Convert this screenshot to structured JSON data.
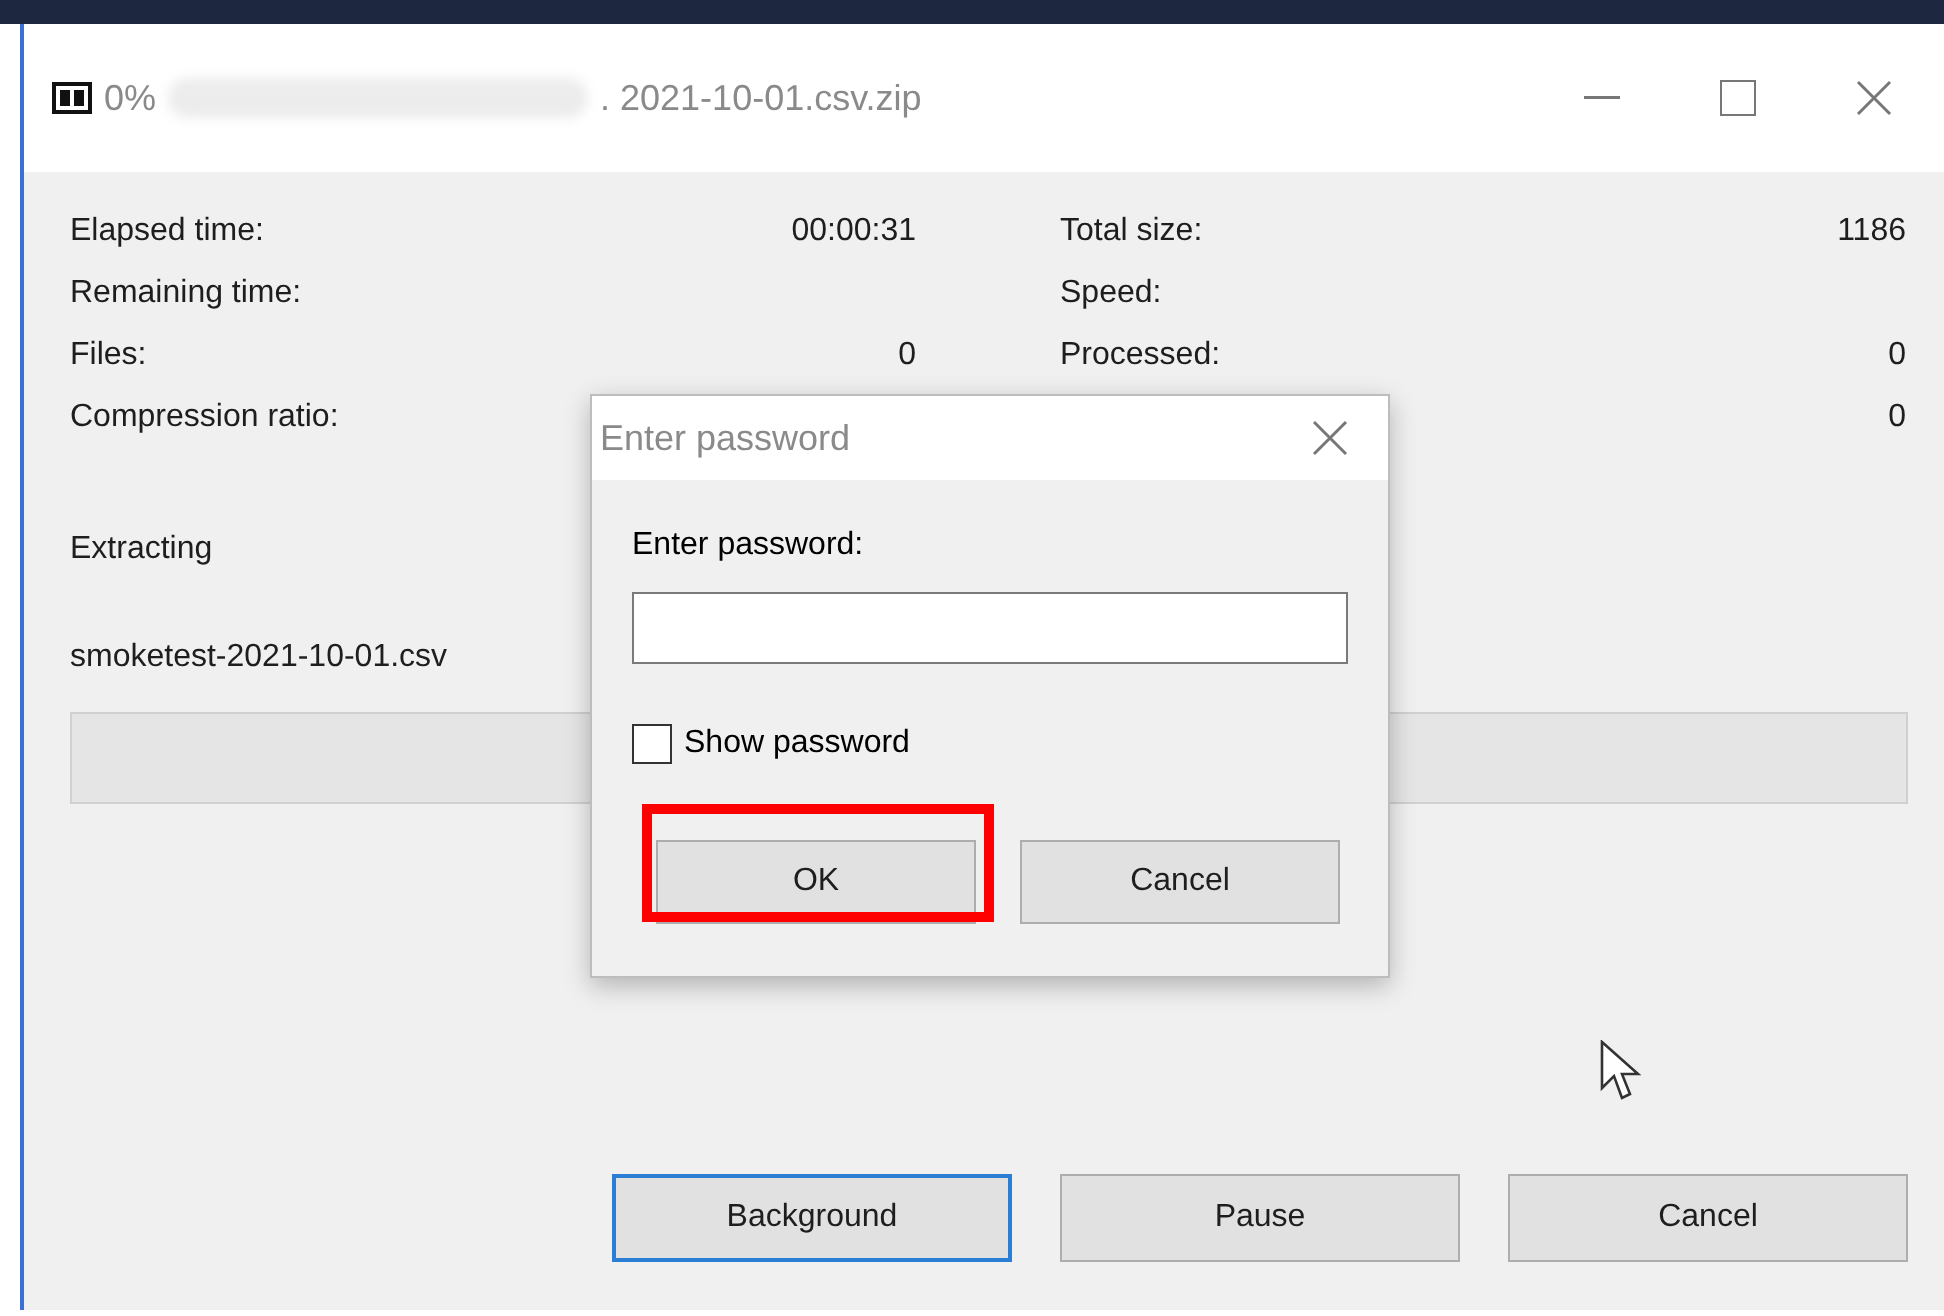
{
  "window": {
    "title_progress": "0%",
    "title_file": ". 2021-10-01.csv.zip"
  },
  "stats_left": [
    {
      "label": "Elapsed time:",
      "value": "00:00:31"
    },
    {
      "label": "Remaining time:"
    },
    {
      "label": "Files:",
      "value": "0"
    },
    {
      "label": "Compression ratio:"
    }
  ],
  "stats_right": [
    {
      "label": "Total size:",
      "value": "1186"
    },
    {
      "label": "Speed:"
    },
    {
      "label": "Processed:",
      "value": "0"
    },
    {
      "value": "0"
    }
  ],
  "status": "Extracting",
  "current_file": "smoketest-2021-10-01.csv",
  "progress": {
    "level": 0
  },
  "buttons": [
    {
      "label": "Background",
      "focused": true
    },
    {
      "label": "Pause",
      "focused": false
    },
    {
      "label": "Cancel",
      "focused": false
    }
  ],
  "dialog": {
    "title": "Enter password",
    "prompt": "Enter password:",
    "show_password": {
      "label": "Show password",
      "checked": false
    },
    "buttons": [
      {
        "label": "OK",
        "highlighted": true
      },
      {
        "label": "Cancel",
        "highlighted": false
      }
    ]
  }
}
